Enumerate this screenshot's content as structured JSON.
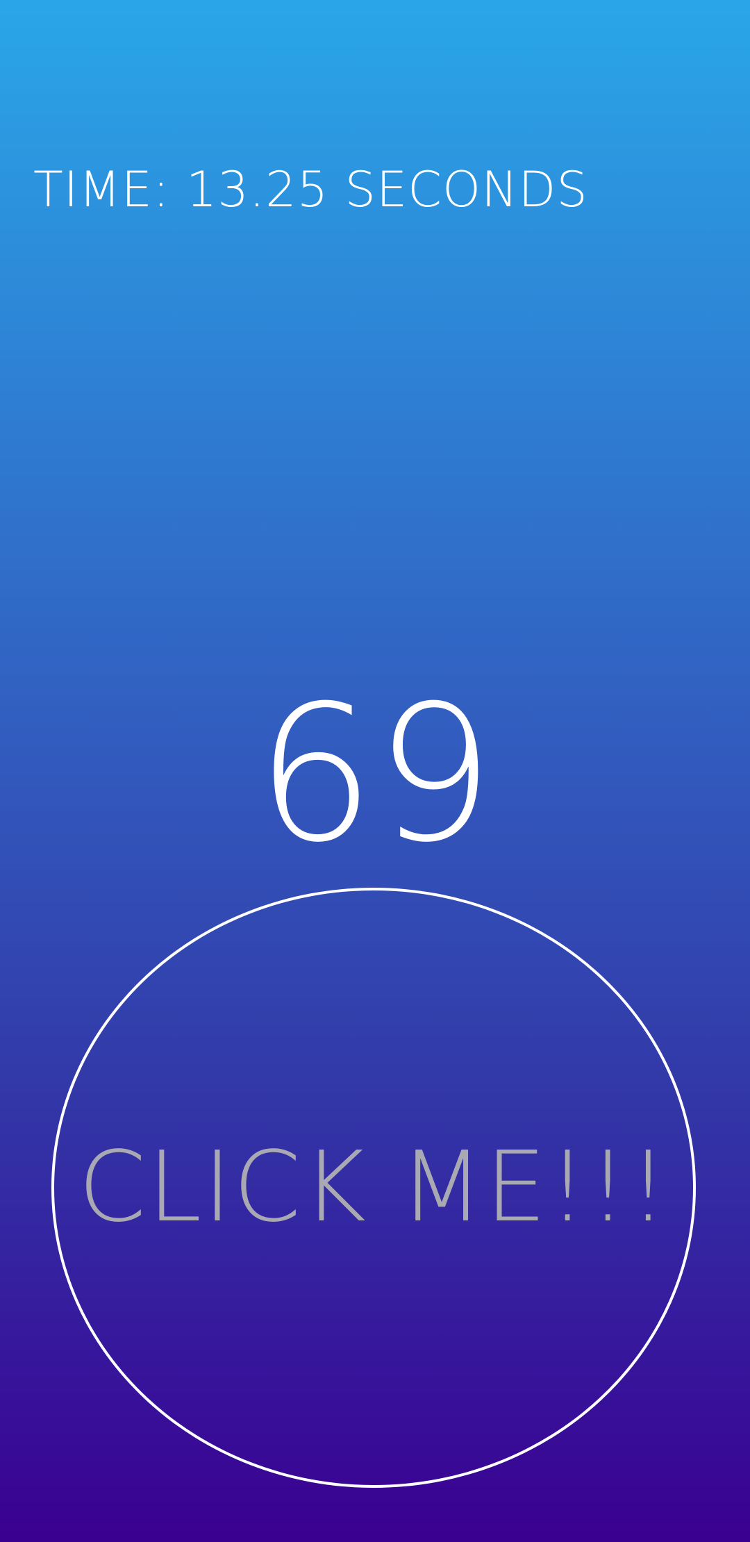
{
  "timer": {
    "text": "TIME: 13.25 SECONDS"
  },
  "score": {
    "value": "69"
  },
  "button": {
    "label": "CLICK ME!!!"
  },
  "colors": {
    "gradient_top": "#2aa6e8",
    "gradient_bottom": "#3a0090",
    "text": "#ffffff",
    "button_label": "#a9a9b3",
    "button_border": "#ffffff"
  }
}
